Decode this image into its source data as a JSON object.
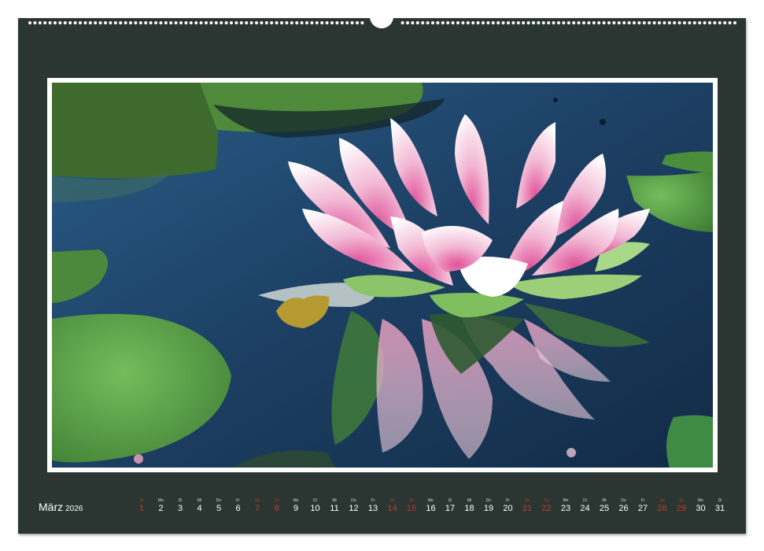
{
  "calendar": {
    "month": "März",
    "year": "2026",
    "board_color": "#2b3633",
    "weekend_color": "#c0392b",
    "days": [
      {
        "wd": "So",
        "num": "1",
        "weekend": true
      },
      {
        "wd": "Mo",
        "num": "2",
        "weekend": false
      },
      {
        "wd": "Di",
        "num": "3",
        "weekend": false
      },
      {
        "wd": "Mi",
        "num": "4",
        "weekend": false
      },
      {
        "wd": "Do",
        "num": "5",
        "weekend": false
      },
      {
        "wd": "Fr",
        "num": "6",
        "weekend": false
      },
      {
        "wd": "Sa",
        "num": "7",
        "weekend": true
      },
      {
        "wd": "So",
        "num": "8",
        "weekend": true
      },
      {
        "wd": "Mo",
        "num": "9",
        "weekend": false
      },
      {
        "wd": "Di",
        "num": "10",
        "weekend": false
      },
      {
        "wd": "Mi",
        "num": "11",
        "weekend": false
      },
      {
        "wd": "Do",
        "num": "12",
        "weekend": false
      },
      {
        "wd": "Fr",
        "num": "13",
        "weekend": false
      },
      {
        "wd": "Sa",
        "num": "14",
        "weekend": true
      },
      {
        "wd": "So",
        "num": "15",
        "weekend": true
      },
      {
        "wd": "Mo",
        "num": "16",
        "weekend": false
      },
      {
        "wd": "Di",
        "num": "17",
        "weekend": false
      },
      {
        "wd": "Mi",
        "num": "18",
        "weekend": false
      },
      {
        "wd": "Do",
        "num": "19",
        "weekend": false
      },
      {
        "wd": "Fr",
        "num": "20",
        "weekend": false
      },
      {
        "wd": "Sa",
        "num": "21",
        "weekend": true
      },
      {
        "wd": "So",
        "num": "22",
        "weekend": true
      },
      {
        "wd": "Mo",
        "num": "23",
        "weekend": false
      },
      {
        "wd": "Di",
        "num": "24",
        "weekend": false
      },
      {
        "wd": "Mi",
        "num": "25",
        "weekend": false
      },
      {
        "wd": "Do",
        "num": "26",
        "weekend": false
      },
      {
        "wd": "Fr",
        "num": "27",
        "weekend": false
      },
      {
        "wd": "Sa",
        "num": "28",
        "weekend": true
      },
      {
        "wd": "So",
        "num": "29",
        "weekend": true
      },
      {
        "wd": "Mo",
        "num": "30",
        "weekend": false
      },
      {
        "wd": "Di",
        "num": "31",
        "weekend": false
      }
    ]
  },
  "photo": {
    "subject": "water-lily-illustration",
    "water_color": "#1d3f62",
    "petal_color": "#f3c6dc",
    "pad_color": "#5fa84a"
  }
}
